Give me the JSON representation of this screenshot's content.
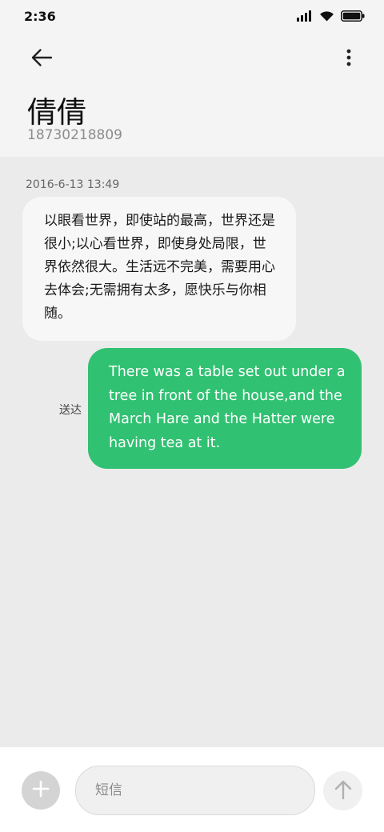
{
  "status_bar": {
    "time": "2:36",
    "icons": [
      "signal-icon",
      "wifi-icon",
      "battery-icon"
    ]
  },
  "header": {
    "back_icon": "back-arrow-icon",
    "more_icon": "more-vertical-icon",
    "contact_name": "倩倩",
    "contact_number": "18730218809"
  },
  "thread": {
    "messages": [
      {
        "direction": "incoming",
        "timestamp": "2016-6-13 13:49",
        "text": "以眼看世界，即使站的最高，世界还是很小;以心看世界，即使身处局限，世界依然很大。生活远不完美，需要用心去体会;无需拥有太多，愿快乐与你相随。"
      },
      {
        "direction": "outgoing",
        "status": "送达",
        "text": "There was a table set out under a tree in front of the house,and the March Hare and the Hatter were having tea at it."
      }
    ]
  },
  "compose": {
    "add_icon": "plus-icon",
    "placeholder": "短信",
    "send_icon": "send-arrow-icon"
  },
  "colors": {
    "outgoing_bubble": "#31c172",
    "incoming_bubble": "#f7f7f7",
    "thread_background": "#ebebeb",
    "header_background": "#f4f4f4"
  }
}
